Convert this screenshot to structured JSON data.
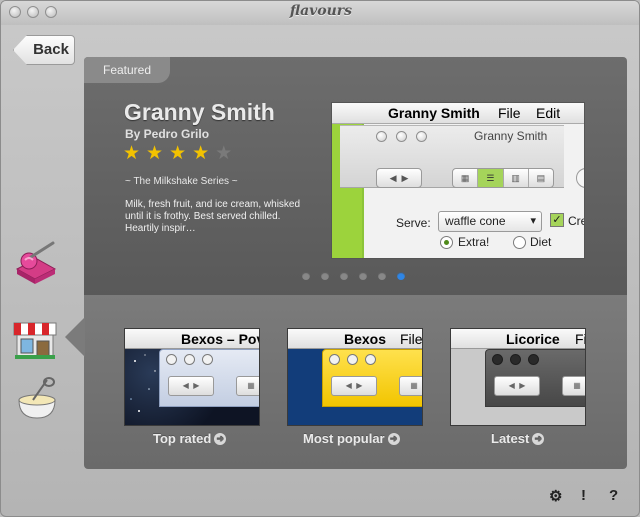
{
  "window": {
    "title": "flavours"
  },
  "sidebar": {
    "back_label": "Back",
    "categories": [
      {
        "icon": "ice-cream-icon"
      },
      {
        "icon": "storefront-icon"
      },
      {
        "icon": "mixing-bowl-icon"
      }
    ]
  },
  "featured": {
    "tab_label": "Featured",
    "title": "Granny Smith",
    "author": "By Pedro Grilo",
    "rating": 4,
    "rating_max": 5,
    "series": "~ The Milkshake Series ~",
    "description": "Milk, fresh fruit, and ice cream, whisked until it is frothy. Best served chilled. Heartily inspir…",
    "preview": {
      "menubar_name": "Granny Smith",
      "menu_file": "File",
      "menu_edit": "Edit",
      "window_title": "Granny Smith",
      "serve_label": "Serve:",
      "serve_value": "waffle cone",
      "checkbox_label": "Cre",
      "radio_extra": "Extra!",
      "radio_diet": "Diet",
      "accent_color": "#9cd33c"
    },
    "pager": {
      "count": 6,
      "active_index": 5
    }
  },
  "collections": [
    {
      "preview_title": "Bexos – Pov",
      "label": "Top rated"
    },
    {
      "preview_title": "Bexos",
      "preview_file": "File",
      "label": "Most popular"
    },
    {
      "preview_title": "Licorice",
      "preview_file": "Fi",
      "label": "Latest"
    }
  ],
  "footer": {
    "settings_glyph": "⚙",
    "info_glyph": "!",
    "help_glyph": "?"
  }
}
